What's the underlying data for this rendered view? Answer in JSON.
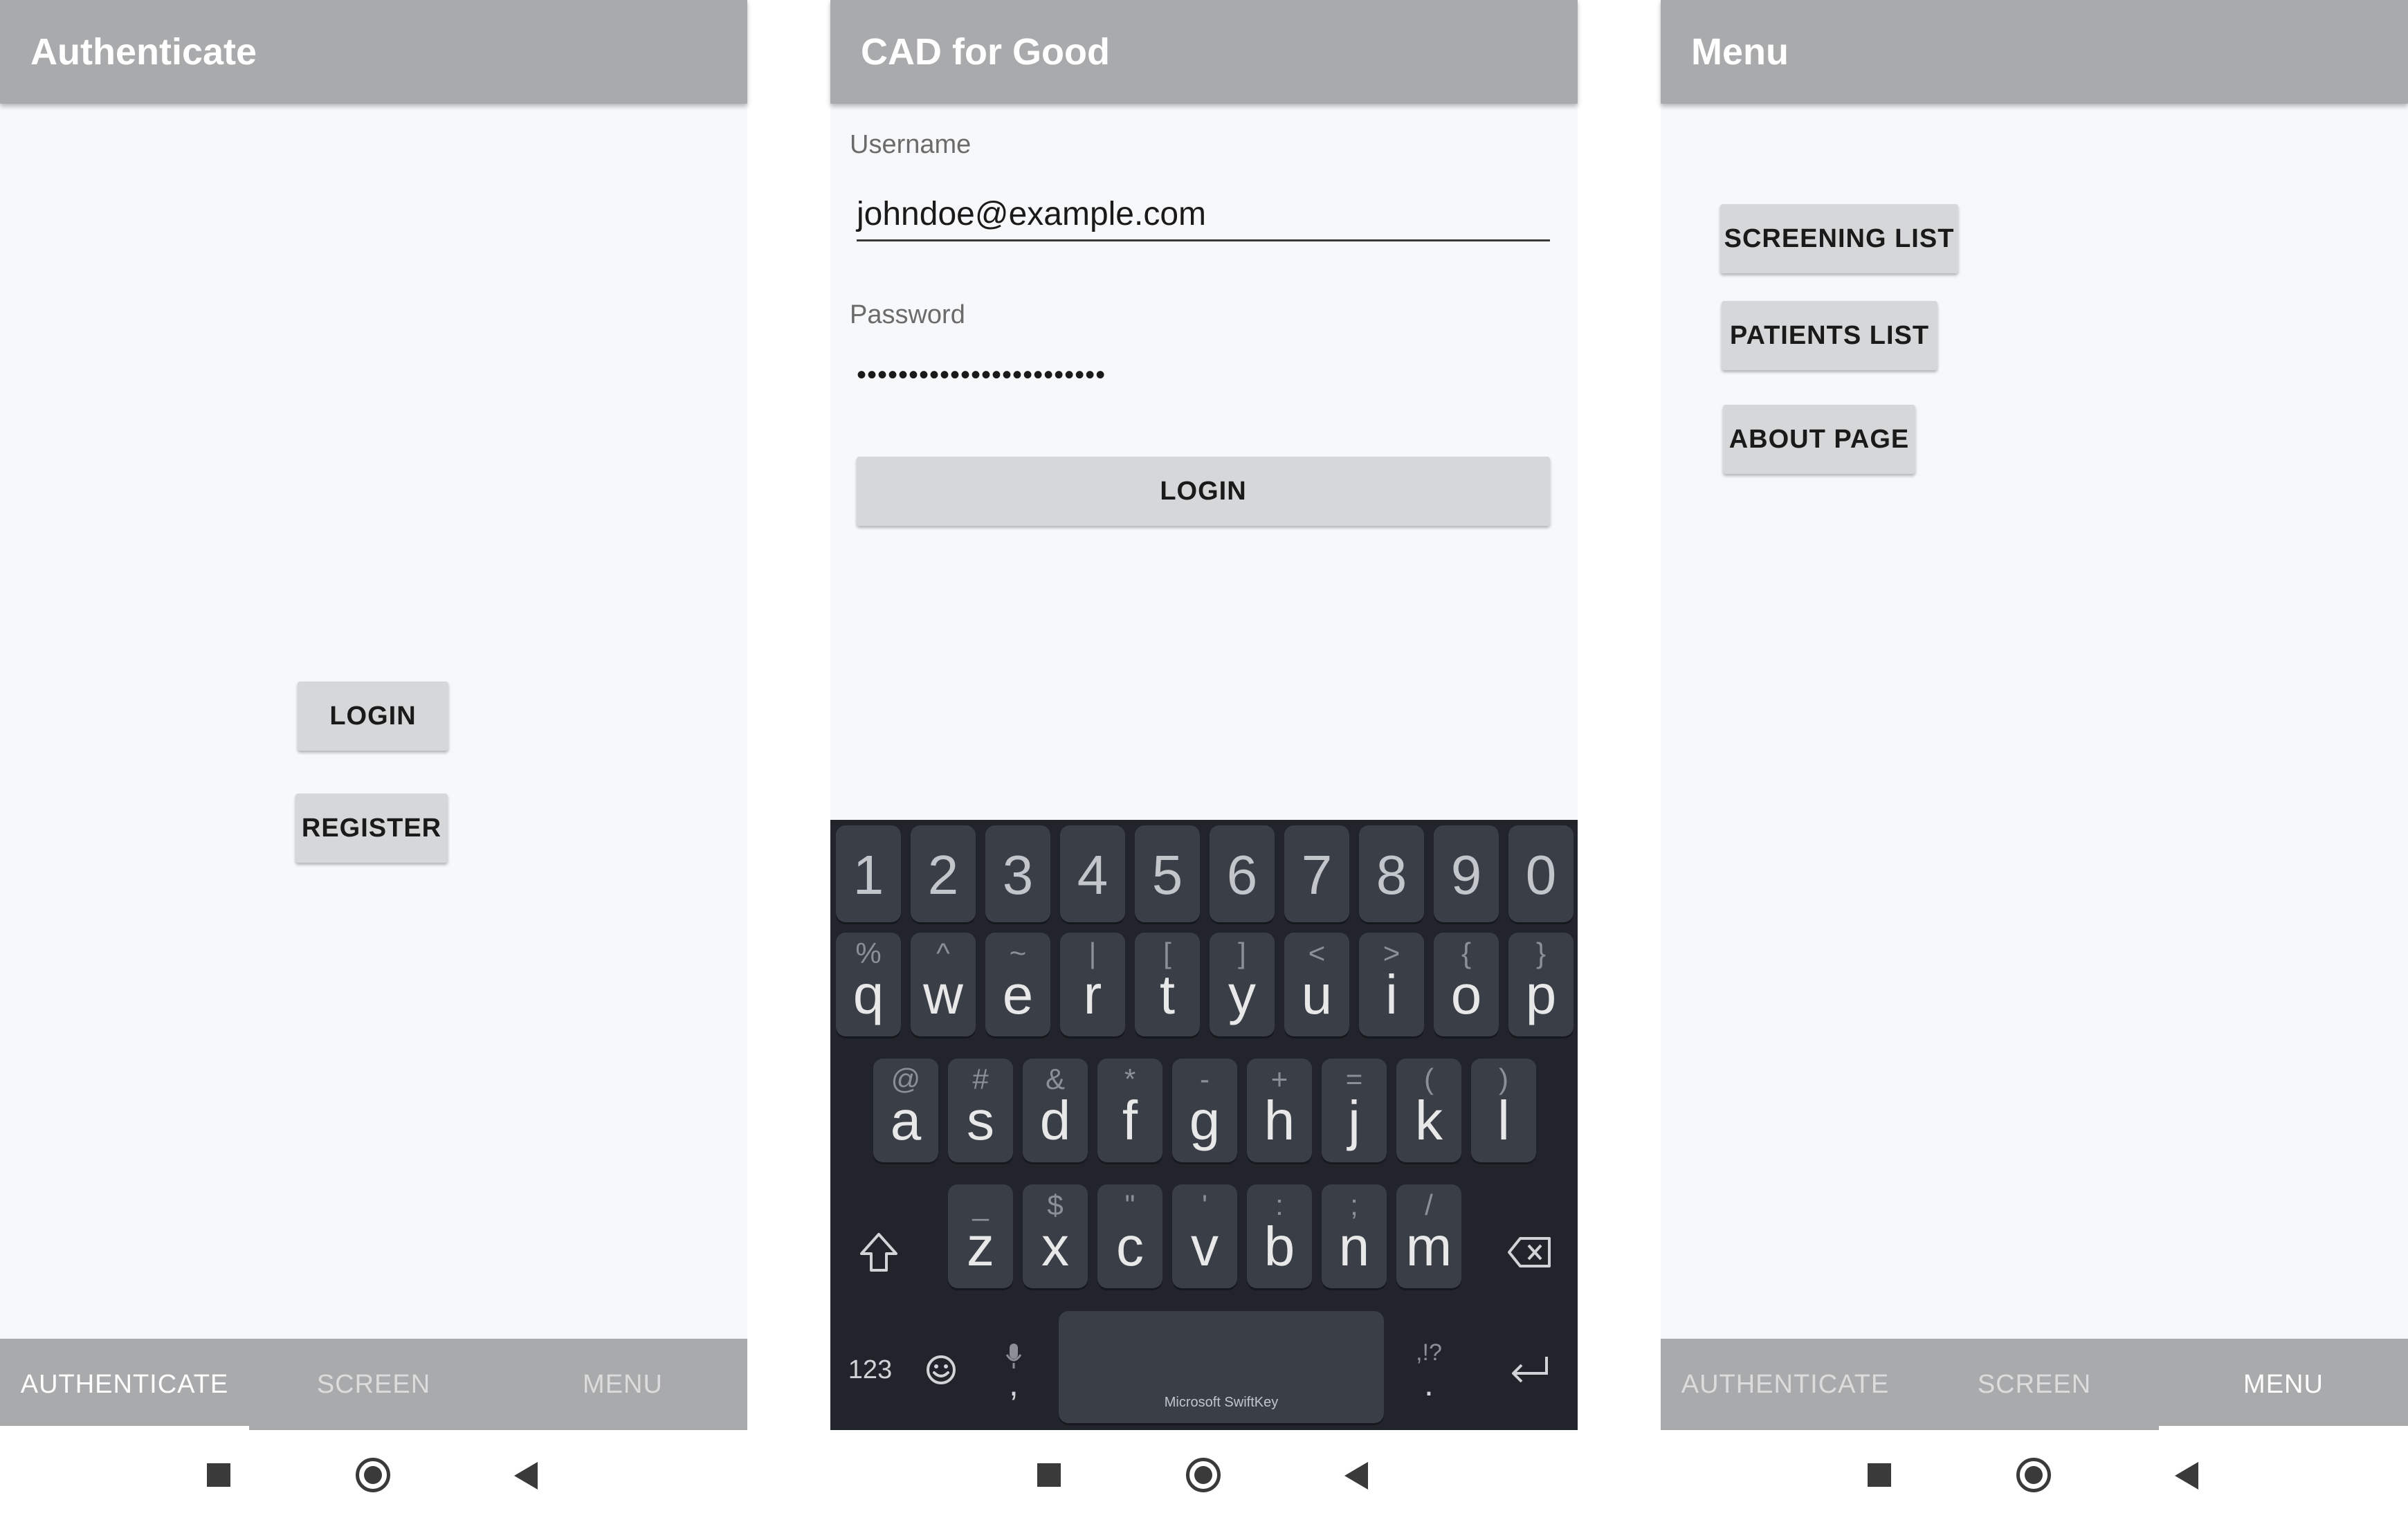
{
  "authenticate_screen": {
    "title": "Authenticate",
    "login_button": "LOGIN",
    "register_button": "REGISTER"
  },
  "login_screen": {
    "title": "CAD for Good",
    "username_label": "Username",
    "username_value": "johndoe@example.com",
    "password_label": "Password",
    "password_value": "••••••••••••••••••••••••",
    "login_button": "LOGIN"
  },
  "menu_screen": {
    "title": "Menu",
    "screening_list_button": "SCREENING LIST",
    "patients_list_button": "PATIENTS LIST",
    "about_page_button": "ABOUT PAGE"
  },
  "tabs": [
    "AUTHENTICATE",
    "SCREEN",
    "MENU"
  ],
  "keyboard": {
    "number_row": [
      "1",
      "2",
      "3",
      "4",
      "5",
      "6",
      "7",
      "8",
      "9",
      "0"
    ],
    "row1": [
      {
        "main": "q",
        "sec": "%"
      },
      {
        "main": "w",
        "sec": "^"
      },
      {
        "main": "e",
        "sec": "~"
      },
      {
        "main": "r",
        "sec": "|"
      },
      {
        "main": "t",
        "sec": "["
      },
      {
        "main": "y",
        "sec": "]"
      },
      {
        "main": "u",
        "sec": "<"
      },
      {
        "main": "i",
        "sec": ">"
      },
      {
        "main": "o",
        "sec": "{"
      },
      {
        "main": "p",
        "sec": "}"
      }
    ],
    "row2": [
      {
        "main": "a",
        "sec": "@"
      },
      {
        "main": "s",
        "sec": "#"
      },
      {
        "main": "d",
        "sec": "&"
      },
      {
        "main": "f",
        "sec": "*"
      },
      {
        "main": "g",
        "sec": "-"
      },
      {
        "main": "h",
        "sec": "+"
      },
      {
        "main": "j",
        "sec": "="
      },
      {
        "main": "k",
        "sec": "("
      },
      {
        "main": "l",
        "sec": ")"
      }
    ],
    "row3": [
      {
        "main": "z",
        "sec": "_"
      },
      {
        "main": "x",
        "sec": "$"
      },
      {
        "main": "c",
        "sec": "\""
      },
      {
        "main": "v",
        "sec": "'"
      },
      {
        "main": "b",
        "sec": ":"
      },
      {
        "main": "n",
        "sec": ";"
      },
      {
        "main": "m",
        "sec": "/"
      }
    ],
    "numbers_key": "123",
    "comma_key": ",",
    "period_key": ".",
    "period_sec": ",!?",
    "space_brand": "Microsoft SwiftKey"
  }
}
